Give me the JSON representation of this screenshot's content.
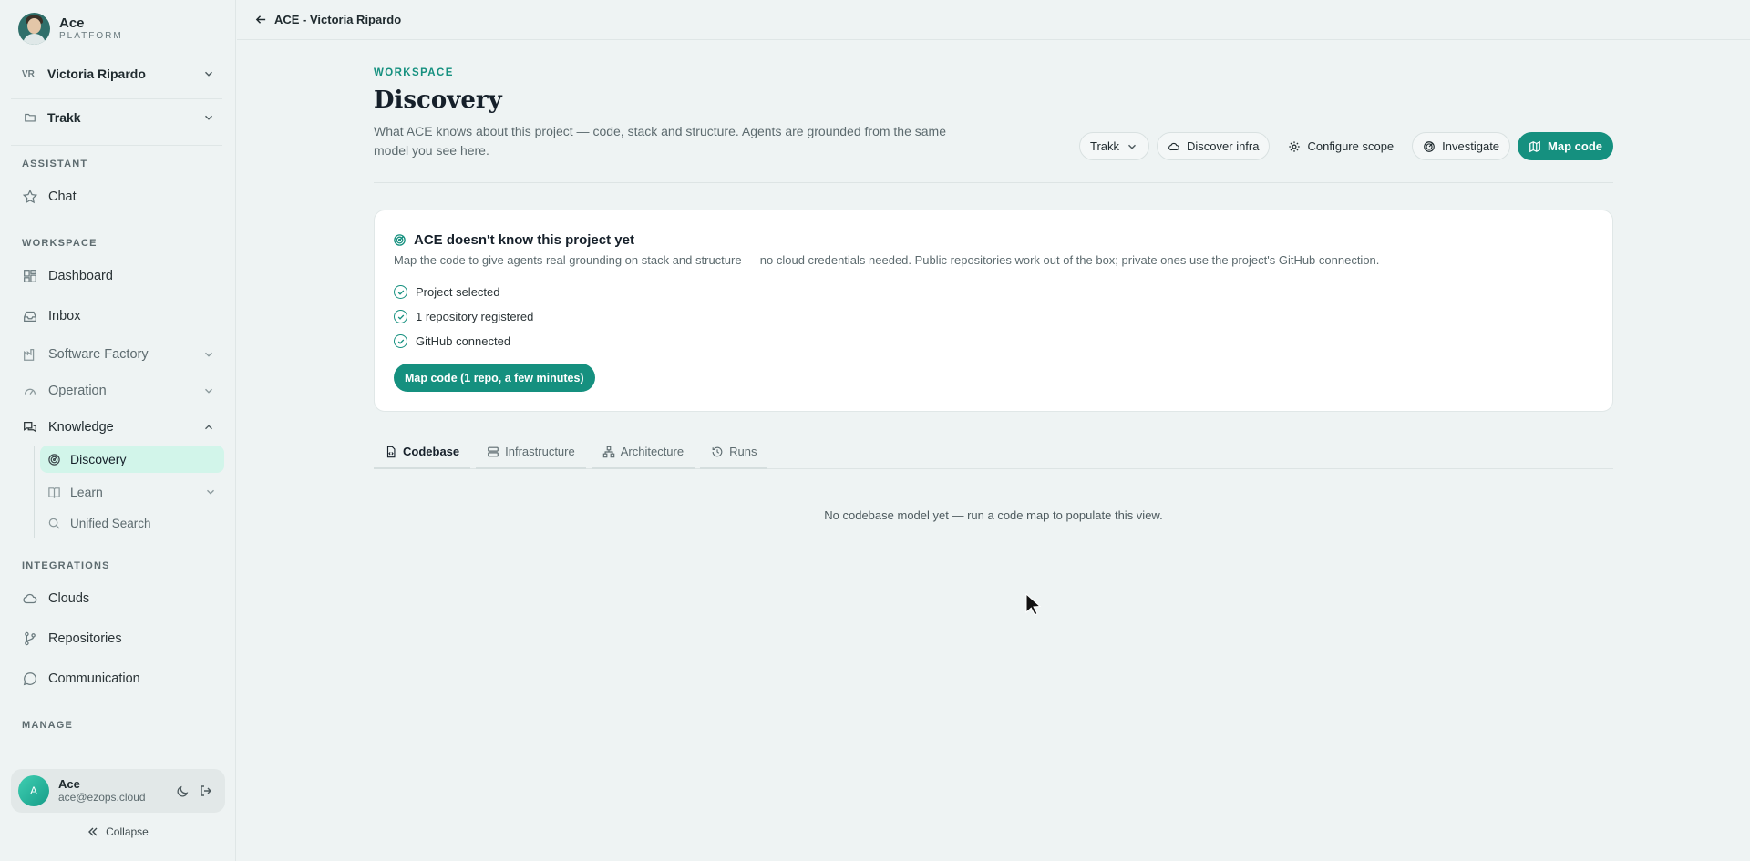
{
  "brand": {
    "name": "Ace",
    "sub": "PLATFORM"
  },
  "org": {
    "initials": "VR",
    "name": "Victoria Ripardo"
  },
  "project": {
    "name": "Trakk"
  },
  "sidebar": {
    "sections": {
      "assistant": "ASSISTANT",
      "workspace": "WORKSPACE",
      "integrations": "INTEGRATIONS",
      "manage": "MANAGE"
    },
    "chat": "Chat",
    "dashboard": "Dashboard",
    "inbox": "Inbox",
    "software_factory": "Software Factory",
    "operation": "Operation",
    "knowledge": "Knowledge",
    "discovery": "Discovery",
    "learn": "Learn",
    "unified_search": "Unified Search",
    "clouds": "Clouds",
    "repositories": "Repositories",
    "communication": "Communication"
  },
  "user": {
    "initial": "A",
    "name": "Ace",
    "email": "ace@ezops.cloud"
  },
  "collapse_label": "Collapse",
  "topbar": {
    "back_label": "ACE - Victoria Ripardo"
  },
  "page": {
    "eyebrow": "WORKSPACE",
    "title": "Discovery",
    "description": "What ACE knows about this project — code, stack and structure. Agents are grounded from the same model you see here."
  },
  "actions": {
    "project_select": "Trakk",
    "discover_infra": "Discover infra",
    "configure_scope": "Configure scope",
    "investigate": "Investigate",
    "map_code": "Map code"
  },
  "card": {
    "title": "ACE doesn't know this project yet",
    "description": "Map the code to give agents real grounding on stack and structure — no cloud credentials needed. Public repositories work out of the box; private ones use the project's GitHub connection.",
    "checks": [
      "Project selected",
      "1 repository registered",
      "GitHub connected"
    ],
    "button": "Map code (1 repo, a few minutes)"
  },
  "tabs": [
    "Codebase",
    "Infrastructure",
    "Architecture",
    "Runs"
  ],
  "empty_state": "No codebase model yet — run a code map to populate this view.",
  "colors": {
    "accent": "#15907f",
    "active_bg": "#d2f5ea",
    "background": "#eef3f3"
  }
}
